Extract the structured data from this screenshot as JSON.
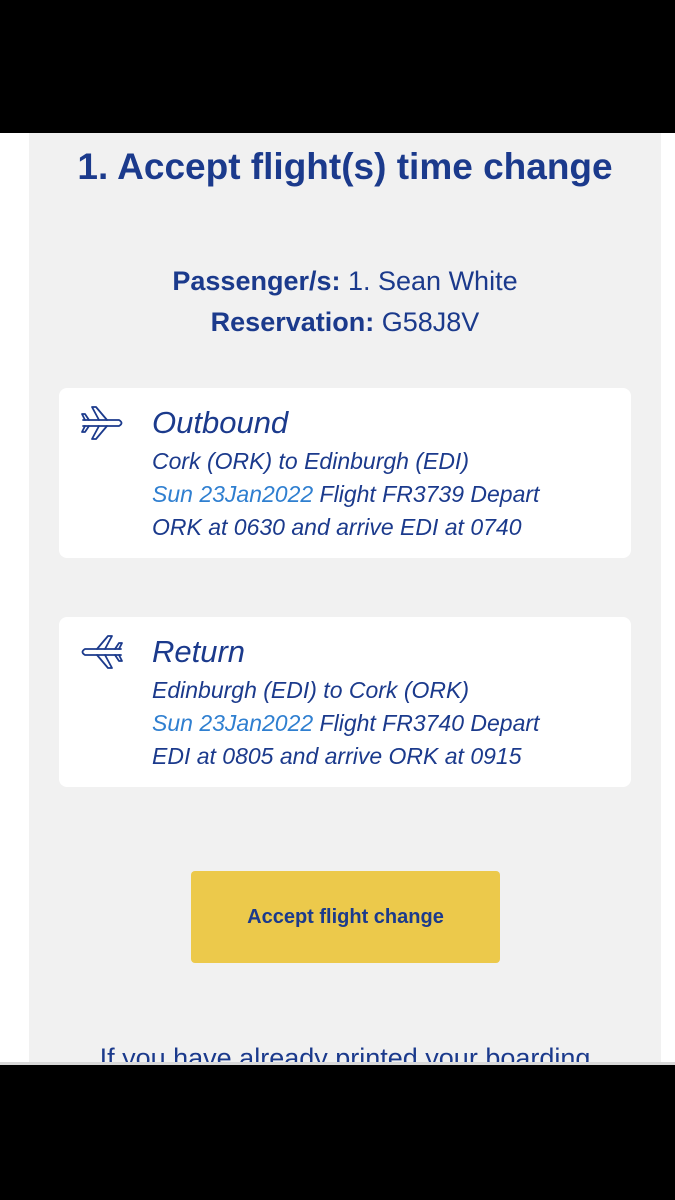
{
  "header": {
    "title": "1. Accept flight(s) time change"
  },
  "booking": {
    "passenger_label": "Passenger/s:",
    "passenger_value": "1. Sean White",
    "reservation_label": "Reservation:",
    "reservation_value": "G58J8V"
  },
  "flights": [
    {
      "heading": "Outbound",
      "route": "Cork (ORK) to Edinburgh (EDI)",
      "date": "Sun 23Jan2022",
      "details_line1": " Flight FR3739 Depart",
      "details_line2": "ORK at 0630 and arrive EDI at 0740",
      "icon": "plane-departure-icon"
    },
    {
      "heading": "Return",
      "route": "Edinburgh (EDI) to Cork (ORK)",
      "date": "Sun 23Jan2022",
      "details_line1": " Flight FR3740 Depart",
      "details_line2": "EDI at 0805 and arrive ORK at 0915",
      "icon": "plane-return-icon"
    }
  ],
  "actions": {
    "accept_label": "Accept flight change"
  },
  "footer": {
    "partial_text": "If you have already printed your boarding"
  },
  "colors": {
    "primary": "#1b3a8c",
    "link": "#2f7fd0",
    "button": "#ecc94b",
    "panel": "#f1f1f1"
  }
}
